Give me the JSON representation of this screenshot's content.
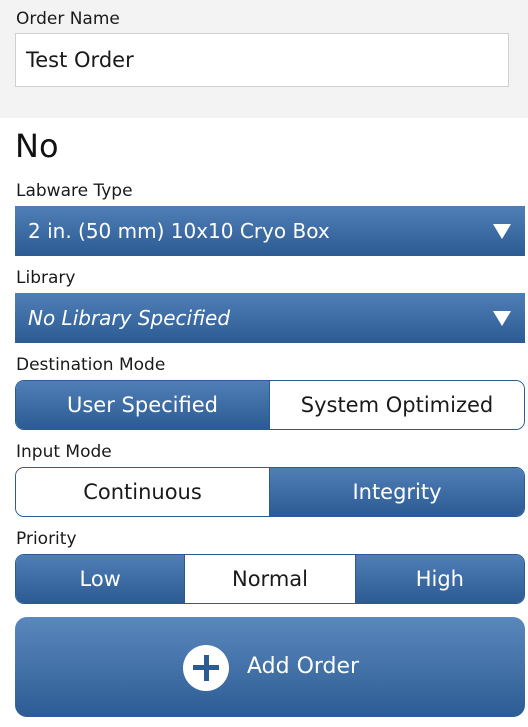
{
  "order": {
    "name_label": "Order Name",
    "name_value": "Test Order"
  },
  "status_text": "No",
  "labware": {
    "label": "Labware Type",
    "selected": "2 in. (50 mm) 10x10 Cryo Box"
  },
  "library": {
    "label": "Library",
    "selected": "No Library Specified"
  },
  "destination_mode": {
    "label": "Destination Mode",
    "options": [
      "User Specified",
      "System Optimized"
    ],
    "selected": "User Specified"
  },
  "input_mode": {
    "label": "Input Mode",
    "options": [
      "Continuous",
      "Integrity"
    ],
    "selected": "Integrity"
  },
  "priority": {
    "label": "Priority",
    "options": [
      "Low",
      "Normal",
      "High"
    ],
    "selected": "Normal"
  },
  "add_order": {
    "label": "Add Order",
    "icon": "plus-circle-icon"
  },
  "colors": {
    "accent_top": "#4f7fb6",
    "accent_bottom": "#2c5b93"
  }
}
